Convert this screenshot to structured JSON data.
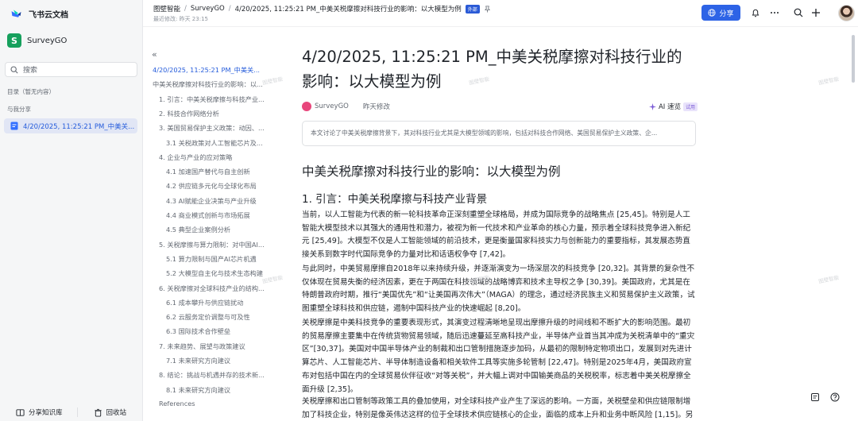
{
  "app": {
    "name": "飞书云文档"
  },
  "sidebar": {
    "space_initial": "S",
    "space_name": "SurveyGO",
    "search_placeholder": "搜索",
    "toc_label": "目录（暂无内容）",
    "shared_label": "与我分享",
    "shared_doc": "4/20/2025, 11:25:21 PM_中美关...",
    "footer_knowledge": "分享知识库",
    "footer_trash": "回收站"
  },
  "topbar": {
    "crumbs": [
      "图壁智能",
      "SurveyGO",
      "4/20/2025, 11:25:21 PM_中美关税摩擦对科技行业的影响：以大模型为例"
    ],
    "external_badge": "外部",
    "modified": "最近修改: 昨天 23:15",
    "share_label": "分享"
  },
  "toc": [
    {
      "label": "4/20/2025, 11:25:21 PM_中美关...",
      "level": 0,
      "active": true
    },
    {
      "label": "中美关税摩擦对科技行业的影响：以...",
      "level": 0,
      "active": false
    },
    {
      "label": "1. 引言：中美关税摩擦与科技产业...",
      "level": 1,
      "active": false
    },
    {
      "label": "2. 科技合作网络分析",
      "level": 1,
      "active": false
    },
    {
      "label": "3. 美国贸易保护主义政策：动因、...",
      "level": 1,
      "active": false
    },
    {
      "label": "3.1 关税政策对人工智能芯片及...",
      "level": 2,
      "active": false
    },
    {
      "label": "4. 企业与产业的应对策略",
      "level": 1,
      "active": false
    },
    {
      "label": "4.1 加速国产替代与自主创新",
      "level": 2,
      "active": false
    },
    {
      "label": "4.2 供应链多元化与全球化布局",
      "level": 2,
      "active": false
    },
    {
      "label": "4.3 AI赋能企业决策与产业升级",
      "level": 2,
      "active": false
    },
    {
      "label": "4.4 商业模式创新与市场拓展",
      "level": 2,
      "active": false
    },
    {
      "label": "4.5 典型企业案例分析",
      "level": 2,
      "active": false
    },
    {
      "label": "5. 关税摩擦与算力限制：对中国AI...",
      "level": 1,
      "active": false
    },
    {
      "label": "5.1 算力限制与国产AI芯片机遇",
      "level": 2,
      "active": false
    },
    {
      "label": "5.2 大模型自主化与技术生态构建",
      "level": 2,
      "active": false
    },
    {
      "label": "6. 关税摩擦对全球科技产业的结构...",
      "level": 1,
      "active": false
    },
    {
      "label": "6.1 成本攀升与供应链扰动",
      "level": 2,
      "active": false
    },
    {
      "label": "6.2 云服务定价调整与可及性",
      "level": 2,
      "active": false
    },
    {
      "label": "6.3 国际技术合作壁垒",
      "level": 2,
      "active": false
    },
    {
      "label": "7. 未来趋势、展望与政策建议",
      "level": 1,
      "active": false
    },
    {
      "label": "7.1 未来研究方向建议",
      "level": 2,
      "active": false
    },
    {
      "label": "8. 结论：挑战与机遇并存的技术新...",
      "level": 1,
      "active": false
    },
    {
      "label": "8.1 未来研究方向建议",
      "level": 2,
      "active": false
    },
    {
      "label": "References",
      "level": 1,
      "active": false
    }
  ],
  "doc": {
    "title": "4/20/2025, 11:25:21 PM_中美关税摩擦对科技行业的影响：以大模型为例",
    "author": "SurveyGO",
    "edited": "昨天修改",
    "ai_label": "AI 速览",
    "ai_badge": "试用",
    "summary": "本文讨论了中美关税摩擦背景下，其对科技行业尤其是大模型领域的影响，包括对科技合作网络、美国贸易保护主义政策、企...",
    "h1": "中美关税摩擦对科技行业的影响：以大模型为例",
    "h2": "1. 引言：中美关税摩擦与科技产业背景",
    "paragraphs": [
      "当前，以人工智能为代表的新一轮科技革命正深刻重塑全球格局，并成为国际竞争的战略焦点 [25,45]。特别是人工智能大模型技术以其强大的通用性和潜力，被视为新一代技术和产业革命的核心力量，预示着全球科技竞争进入新纪元 [25,49]。大模型不仅是人工智能领域的前沿技术，更是衡量国家科技实力与创新能力的重要指标，其发展态势直接关系到数字时代国际竞争的力量对比和话语权争夺 [7,42]。",
      "与此同时，中美贸易摩擦自2018年以来持续升级，并逐渐演变为一场深层次的科技竞争 [20,32]。其背景的复杂性不仅体现在贸易失衡的经济因素，更在于两国在科技领域的战略博弈和技术主导权之争 [30,39]。美国政府，尤其是在特朗普政府时期，推行“美国优先”和“让美国再次伟大”（MAGA）的理念，通过经济民族主义和贸易保护主义政策，试图重塑全球科技和供应链，遏制中国科技产业的快速崛起 [8,20]。",
      "关税摩擦是中美科技竞争的重要表现形式，其演变过程清晰地呈现出摩擦升级的时间线和不断扩大的影响范围。最初的贸易摩擦主要集中在传统货物贸易领域，随后迅速蔓延至高科技产业，半导体产业首当其冲成为关税清单中的“重灾区”[30,37]。美国对中国半导体产业的制裁和出口管制措施逐步加码，从最初的限制特定物项出口，发展到对先进计算芯片、人工智能芯片、半导体制造设备和相关软件工具等实施多轮管制 [22,47]。特别是2025年4月，美国政府宣布对包括中国在内的全球贸易伙伴征收“对等关税”，并大幅上调对中国输美商品的关税税率，标志着中美关税摩擦全面升级 [2,35]。",
      "关税摩擦和出口管制等政策工具的叠加使用，对全球科技产业产生了深远的影响。一方面，关税壁垒和供应链限制增加了科技企业，特别是像英伟达这样的位于全球技术供应链核心的企业，面临的成本上升和业务中断风险 [1,15]。另"
    ]
  },
  "watermark": "图壁智能"
}
